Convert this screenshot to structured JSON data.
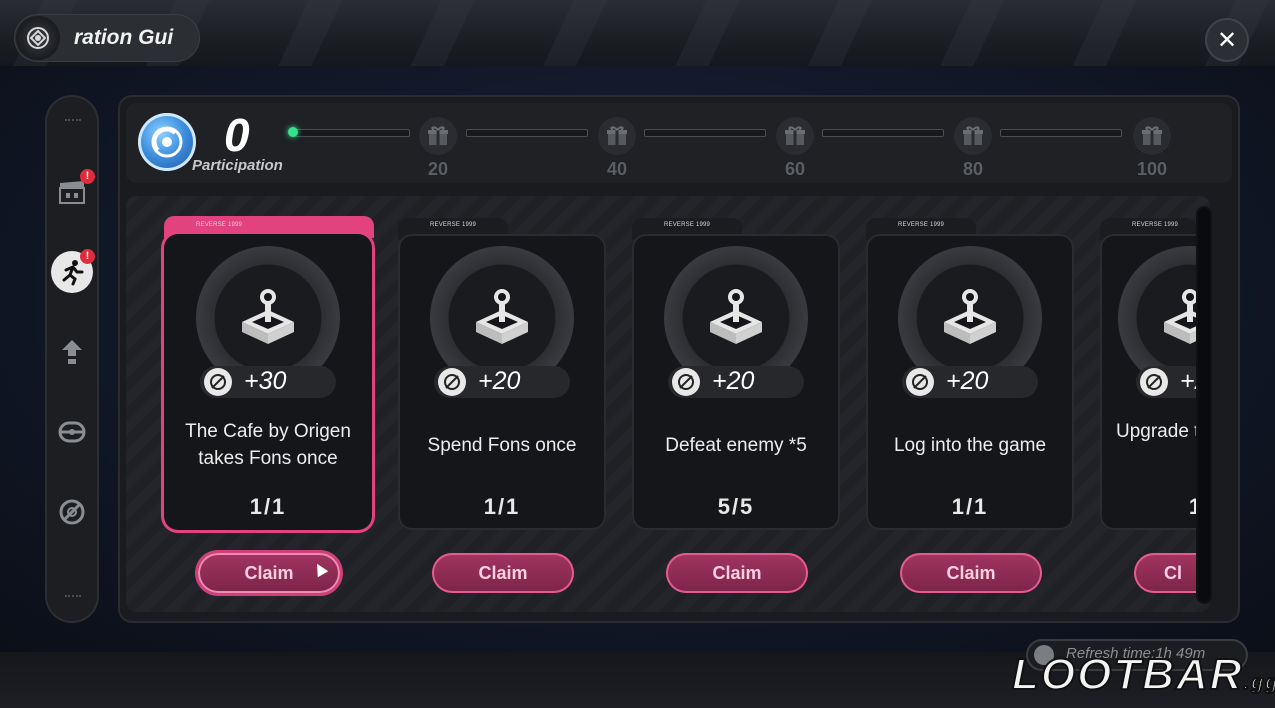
{
  "header": {
    "title": "ration Gui",
    "close_label": "✕"
  },
  "participation": {
    "value": "0",
    "label": "Participation"
  },
  "milestones": [
    "20",
    "40",
    "60",
    "80",
    "100"
  ],
  "sidebar": {
    "badge": "!"
  },
  "cards": [
    {
      "tab": "REVERSE 1999",
      "points": "+30",
      "task": "The Cafe by Origen takes Fons once",
      "progress": "1/1",
      "claim": "Claim"
    },
    {
      "tab": "REVERSE 1999",
      "points": "+20",
      "task": "Spend Fons once",
      "progress": "1/1",
      "claim": "Claim"
    },
    {
      "tab": "REVERSE 1999",
      "points": "+20",
      "task": "Defeat enemy *5",
      "progress": "5/5",
      "claim": "Claim"
    },
    {
      "tab": "REVERSE 1999",
      "points": "+20",
      "task": "Log into the game",
      "progress": "1/1",
      "claim": "Claim"
    },
    {
      "tab": "REVERSE 1999",
      "points": "+2",
      "task": "Upgrade ti",
      "progress": "1",
      "claim": "Cl"
    }
  ],
  "footer": {
    "refresh": "Refresh time:1h 49m",
    "watermark": "LOOTBAR",
    "watermark_suffix": ".gg"
  },
  "colors": {
    "accent": "#e2427e",
    "progress_dot": "#33e28a"
  }
}
